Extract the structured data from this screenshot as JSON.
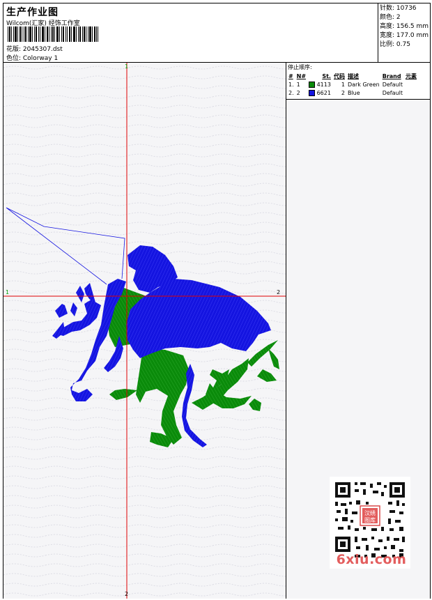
{
  "header": {
    "title": "生产作业图",
    "company": "Wilcom(汇家) 经饰工作室",
    "design_label": "花版: 2045307.dst",
    "colorway_label": "色位: Colorway 1"
  },
  "stats": {
    "stitches": "针数: 10736",
    "colors": "颜色: 2",
    "height": "高度: 156.5 mm",
    "width": "宽度: 177.0 mm",
    "scale": "比例: 0.75"
  },
  "stop_sequence": {
    "title": "停止顺序:",
    "headers": [
      "#",
      "N#",
      "St.",
      "代码",
      "描述",
      "Brand",
      "元素"
    ],
    "rows": [
      {
        "idx": "1.",
        "n": "1",
        "st": "4113",
        "code": "1",
        "desc": "Dark Green",
        "brand": "Default",
        "color": "#0a8a0a"
      },
      {
        "idx": "2.",
        "n": "2",
        "st": "6621",
        "code": "2",
        "desc": "Blue",
        "brand": "Default",
        "color": "#1414e0"
      }
    ]
  },
  "axis_labels": {
    "top": "1",
    "bottom": "2",
    "left": "1",
    "right": "2"
  },
  "watermark": {
    "text": "6xiu.com",
    "stamp": "汉绣图库"
  },
  "colors": {
    "thread_green": "#0a8a0a",
    "thread_blue": "#1414e0",
    "crosshair": "#e00000"
  }
}
